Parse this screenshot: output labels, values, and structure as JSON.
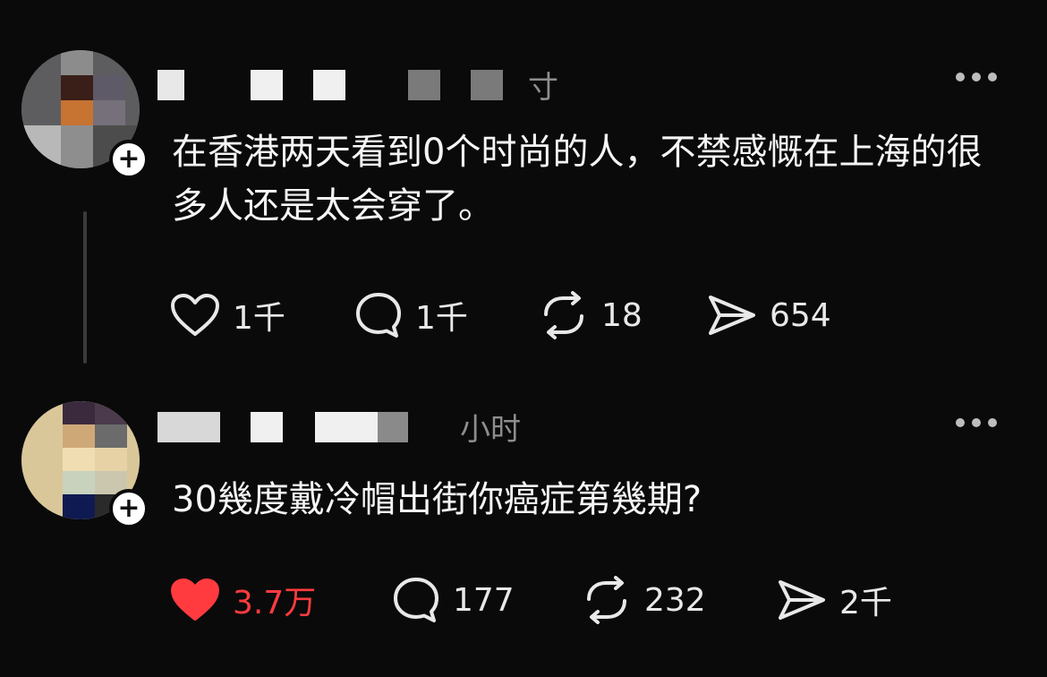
{
  "posts": [
    {
      "time_text": "寸",
      "text": "在香港两天看到0个时尚的人，不禁感慨在上海的很多人还是太会穿了。",
      "actions": {
        "likes": "1千",
        "comments": "1千",
        "reposts": "18",
        "shares": "654"
      },
      "liked": false
    },
    {
      "time_text": "小时",
      "text": "30幾度戴冷帽出街你癌症第幾期?",
      "actions": {
        "likes": "3.7万",
        "comments": "177",
        "reposts": "232",
        "shares": "2千"
      },
      "liked": true
    }
  ],
  "colors": {
    "background": "#0a0a0a",
    "text": "#f5f5f5",
    "muted": "#8d8d8d",
    "like_active": "#ff3b3f"
  },
  "icons": [
    "heart-icon",
    "comment-icon",
    "repost-icon",
    "share-icon",
    "more-icon",
    "follow-plus-icon"
  ]
}
